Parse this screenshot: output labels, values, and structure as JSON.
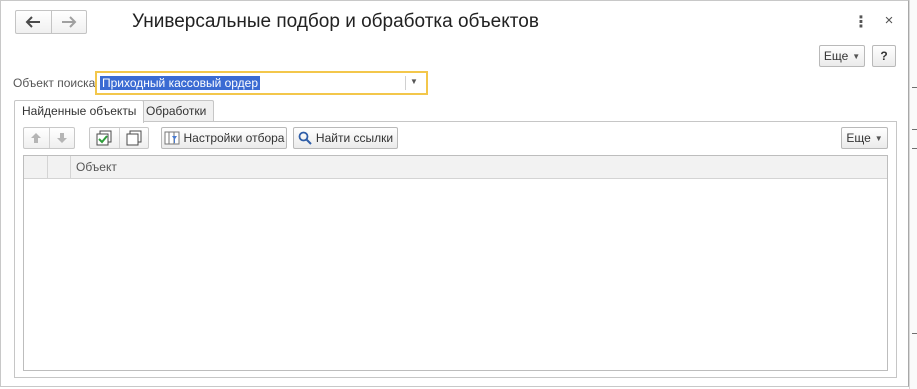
{
  "window": {
    "title": "Универсальные подбор и обработка объектов",
    "nav_back_icon": "arrow-left-icon",
    "nav_forward_icon": "arrow-right-icon",
    "menu_glyph": "⋮",
    "close_glyph": "×"
  },
  "header": {
    "more_label": "Еще",
    "help_label": "?"
  },
  "search": {
    "label": "Объект поиска:",
    "value": "Приходный кассовый ордер"
  },
  "tabs": [
    {
      "label": "Найденные объекты",
      "active": true
    },
    {
      "label": "Обработки",
      "active": false
    }
  ],
  "toolbar": {
    "move_up_icon": "arrow-up-icon",
    "move_down_icon": "arrow-down-icon",
    "check_all_icon": "check-all-icon",
    "uncheck_all_icon": "uncheck-all-icon",
    "filter_settings_label": "Настройки отбора",
    "find_refs_label": "Найти ссылки",
    "more_label": "Еще"
  },
  "table": {
    "columns": [
      "",
      "",
      "Объект"
    ],
    "rows": []
  },
  "colors": {
    "focus_border": "#f3c74b",
    "selection": "#3b6bd3"
  }
}
